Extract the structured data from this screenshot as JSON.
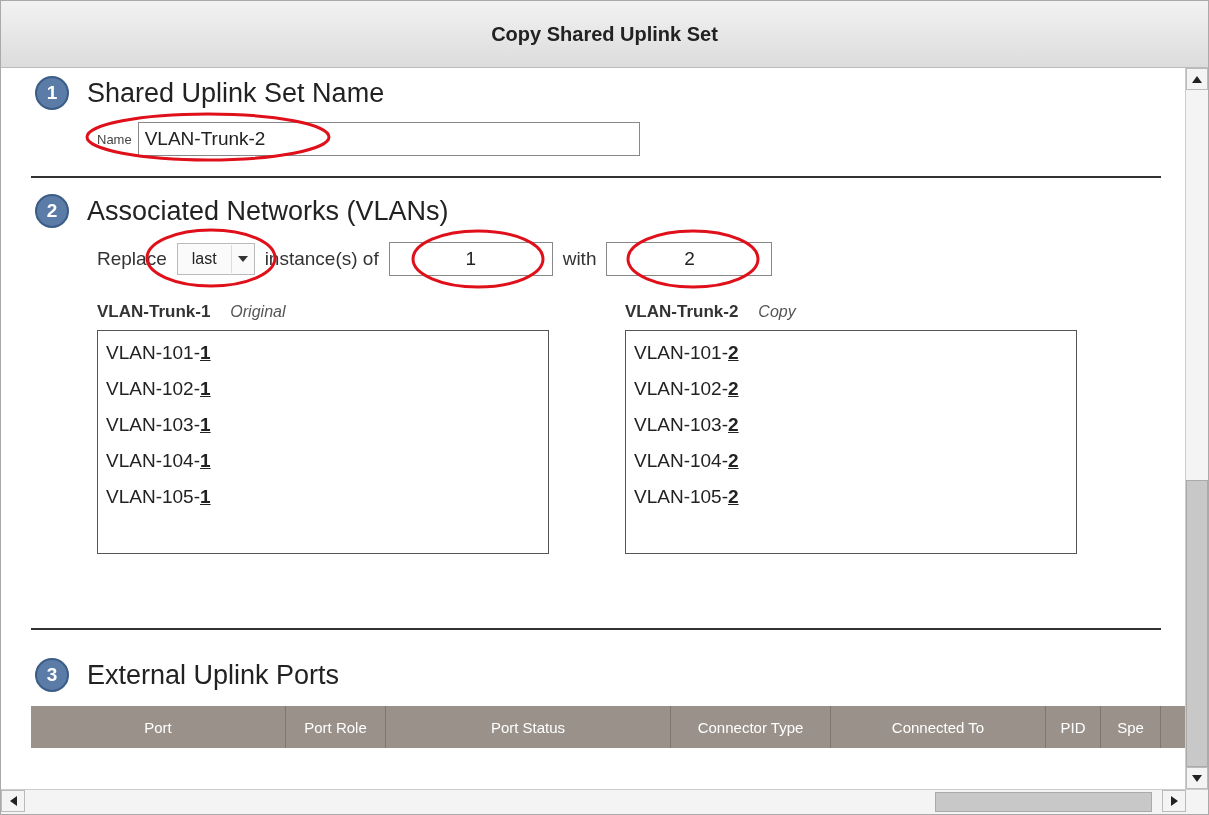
{
  "window": {
    "title": "Copy Shared Uplink Set"
  },
  "sections": [
    {
      "number": "1",
      "title": "Shared Uplink Set Name"
    },
    {
      "number": "2",
      "title": "Associated Networks (VLANs)"
    },
    {
      "number": "3",
      "title": "External Uplink Ports"
    }
  ],
  "name_field": {
    "label": "Name",
    "value": "VLAN-Trunk-2",
    "circled": true
  },
  "replace": {
    "label": "Replace",
    "select": {
      "value": "last",
      "circled": true
    },
    "middle_label": "instance(s) of",
    "from": {
      "value": "1",
      "circled": true
    },
    "with_label": "with",
    "to": {
      "value": "2",
      "circled": true
    }
  },
  "lists": [
    {
      "title": "VLAN-Trunk-1",
      "subtitle": "Original",
      "items": [
        {
          "text": "VLAN-101-",
          "replaced": "1"
        },
        {
          "text": "VLAN-102-",
          "replaced": "1"
        },
        {
          "text": "VLAN-103-",
          "replaced": "1"
        },
        {
          "text": "VLAN-104-",
          "replaced": "1"
        },
        {
          "text": "VLAN-105-",
          "replaced": "1"
        }
      ]
    },
    {
      "title": "VLAN-Trunk-2",
      "subtitle": "Copy",
      "items": [
        {
          "text": "VLAN-101-",
          "replaced": "2"
        },
        {
          "text": "VLAN-102-",
          "replaced": "2"
        },
        {
          "text": "VLAN-103-",
          "replaced": "2"
        },
        {
          "text": "VLAN-104-",
          "replaced": "2"
        },
        {
          "text": "VLAN-105-",
          "replaced": "2"
        }
      ]
    }
  ],
  "table": {
    "columns": [
      "Port",
      "Port Role",
      "Port Status",
      "Connector Type",
      "Connected To",
      "PID",
      "Spe"
    ]
  }
}
